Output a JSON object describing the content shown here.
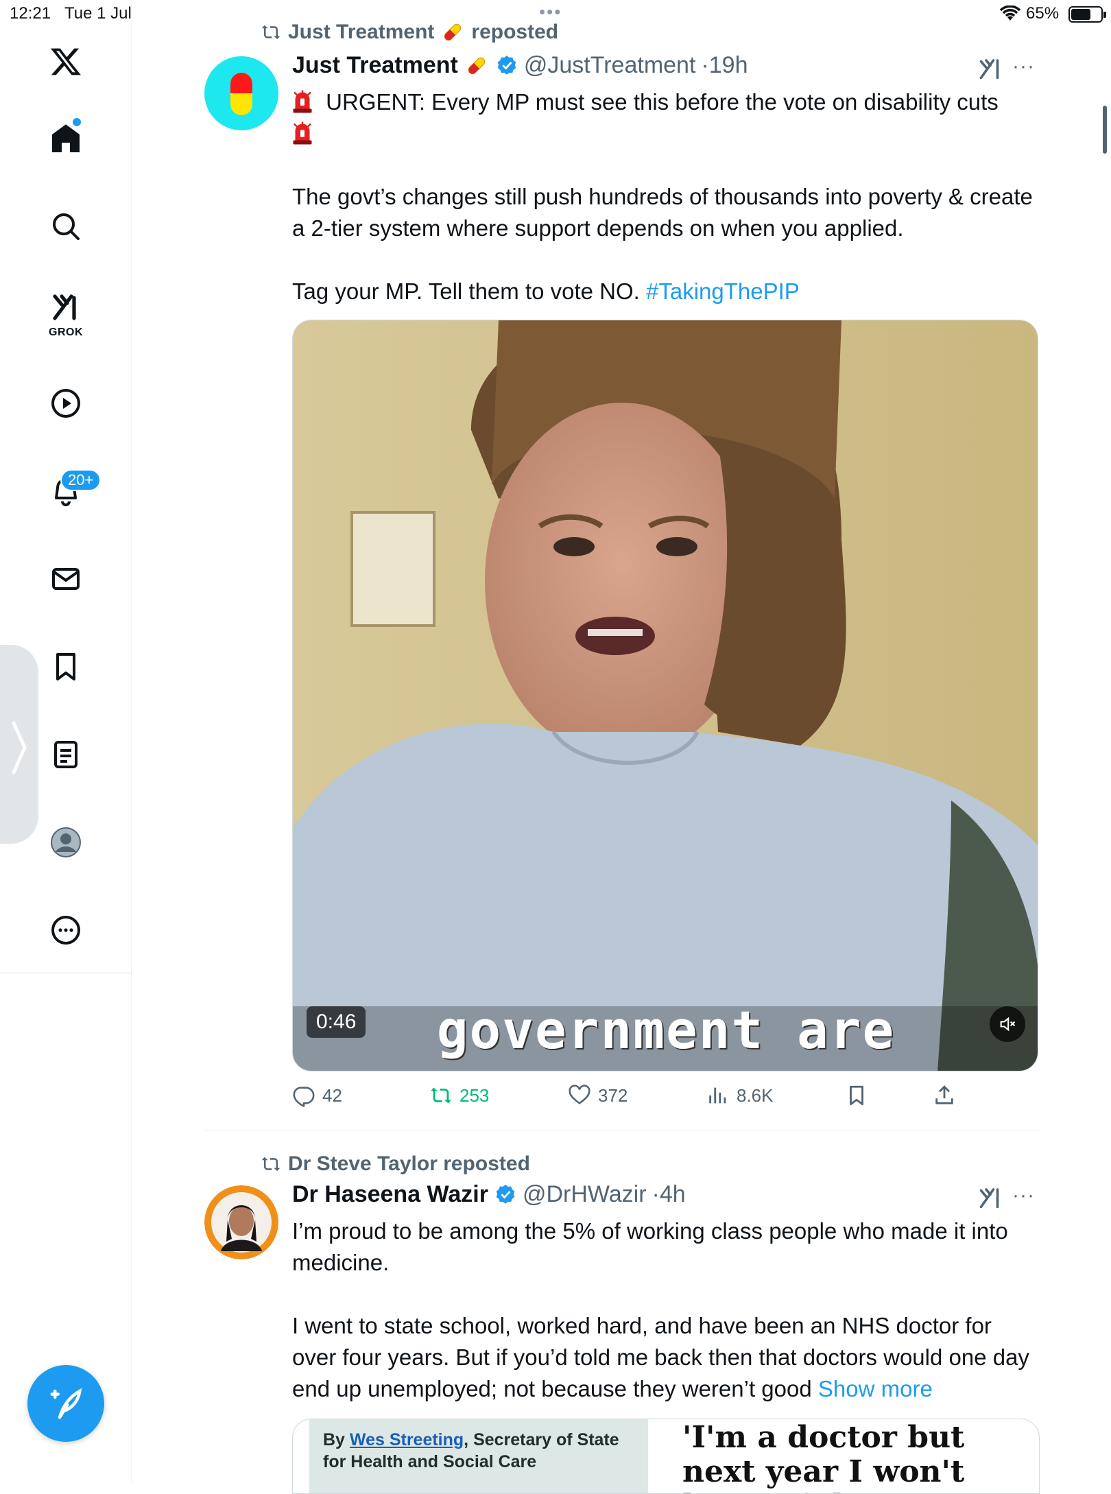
{
  "status_bar": {
    "time": "12:21",
    "date": "Tue 1 Jul",
    "battery": "65%",
    "battery_level": 0.65
  },
  "sidebar": {
    "items": [
      {
        "name": "home",
        "icon": "home-icon"
      },
      {
        "name": "search",
        "icon": "search-icon"
      },
      {
        "name": "grok",
        "icon": "grok-icon",
        "label": "GROK"
      },
      {
        "name": "video",
        "icon": "play-icon"
      },
      {
        "name": "notifications",
        "icon": "bell-icon",
        "badge": "20+"
      },
      {
        "name": "messages",
        "icon": "mail-icon"
      },
      {
        "name": "bookmarks",
        "icon": "bookmark-icon"
      },
      {
        "name": "articles",
        "icon": "article-icon"
      },
      {
        "name": "profile",
        "icon": "avatar-icon"
      },
      {
        "name": "more",
        "icon": "more-icon"
      }
    ]
  },
  "tweets": [
    {
      "repost_by": "Just Treatment",
      "repost_suffix": "reposted",
      "name": "Just Treatment",
      "handle": "@JustTreatment",
      "time": "·19h",
      "line1": "URGENT: Every MP must see this before the vote on disability cuts",
      "para2": "The govt’s changes still push hundreds of thousands into poverty & create a 2-tier system where support depends on when you applied.",
      "para3_text": "Tag your MP. Tell them to vote NO.",
      "hashtag": "#TakingThePIP",
      "video": {
        "duration": "0:46",
        "caption": "government are"
      },
      "stats": {
        "replies": "42",
        "reposts": "253",
        "likes": "372",
        "views": "8.6K"
      }
    },
    {
      "repost_by": "Dr Steve Taylor reposted",
      "name": "Dr Haseena Wazir",
      "handle": "@DrHWazir",
      "time": "·4h",
      "para1": "I’m proud to be among the 5% of working class people who made it into medicine.",
      "para2": "I went to state school, worked hard, and have been an NHS doctor for over four years. But if you’d told me back then that doctors would one day end up unemployed; not because they weren’t good",
      "show_more": "Show more",
      "card": {
        "by": "By",
        "author": "Wes Streeting",
        "role": ", Secretary of State for Health and Social Care",
        "headline": "'I'm a doctor but next year I won't have a job'"
      }
    }
  ],
  "colors": {
    "accent": "#1d9bf0",
    "repost_green": "#00ba7c",
    "secondary_text": "#536471"
  }
}
